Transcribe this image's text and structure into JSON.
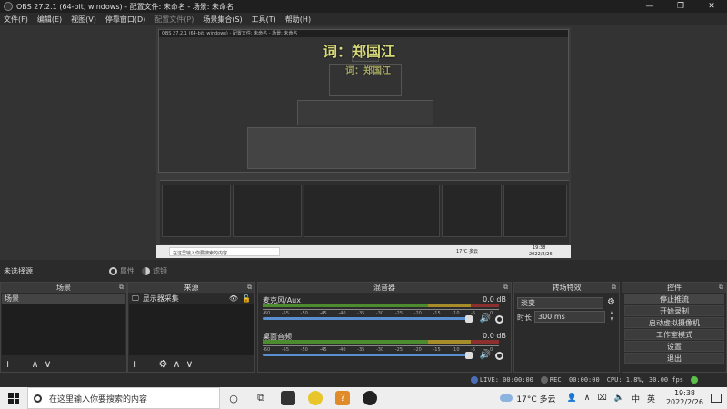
{
  "window": {
    "title": "OBS 27.2.1 (64-bit, windows) - 配置文件: 未命名 - 场景: 未命名"
  },
  "window_controls": {
    "minimize": "—",
    "maximize": "❐",
    "close": "✕"
  },
  "menu": {
    "file": "文件(F)",
    "edit": "编辑(E)",
    "view": "视图(V)",
    "docks": "停靠窗口(D)",
    "profile": "配置文件(P)",
    "scene_collection": "场景集合(S)",
    "tools": "工具(T)",
    "help": "帮助(H)"
  },
  "preview": {
    "lyric": "词：郑国江",
    "lyric_echo": "词：郑国江",
    "nested_title": "OBS 27.2.1 (64-bit, windows) - 配置文件: 未命名 - 场景: 未命名",
    "nested_search": "在这里输入你要搜索的内容",
    "nested_weather": "17°C 多云",
    "nested_time": "19:38",
    "nested_date": "2022/2/26"
  },
  "scene_info": {
    "no_source": "未选择源",
    "properties": "属性",
    "filters": "滤镜"
  },
  "scenes": {
    "header": "场景",
    "items": [
      {
        "label": "场景"
      }
    ]
  },
  "sources": {
    "header": "来源",
    "items": [
      {
        "label": "显示器采集",
        "visible": true,
        "locked": false
      }
    ]
  },
  "mixer": {
    "header": "混音器",
    "channels": [
      {
        "name": "麦克风/Aux",
        "db": "0.0 dB",
        "volume": 1.0
      },
      {
        "name": "桌面音频",
        "db": "0.0 dB",
        "volume": 1.0
      }
    ],
    "tick_labels": [
      "-60",
      "-55",
      "-50",
      "-45",
      "-40",
      "-35",
      "-30",
      "-25",
      "-20",
      "-15",
      "-10",
      "-5",
      "0"
    ]
  },
  "transitions": {
    "header": "转场特效",
    "selected": "淡变",
    "duration_label": "时长",
    "duration_value": "300 ms"
  },
  "controls": {
    "header": "控件",
    "stop_stream": "停止推流",
    "start_record": "开始录制",
    "start_virtualcam": "启动虚拟摄像机",
    "studio_mode": "工作室模式",
    "settings": "设置",
    "exit": "退出"
  },
  "status": {
    "live": "LIVE: 00:00:00",
    "rec": "REC: 00:00:00",
    "cpu": "CPU: 1.8%, 30.00 fps"
  },
  "taskbar": {
    "search_placeholder": "在这里输入你要搜索的内容",
    "weather": "17°C 多云",
    "ime": "中",
    "lang": "英",
    "time": "19:38",
    "date": "2022/2/26"
  },
  "colors": {
    "accent": "#5a8fcf",
    "meter_green": "#4c8c2f",
    "meter_yellow": "#a68d2a",
    "meter_red": "#8c2f2f",
    "panel_bg": "#2b2b2b"
  }
}
